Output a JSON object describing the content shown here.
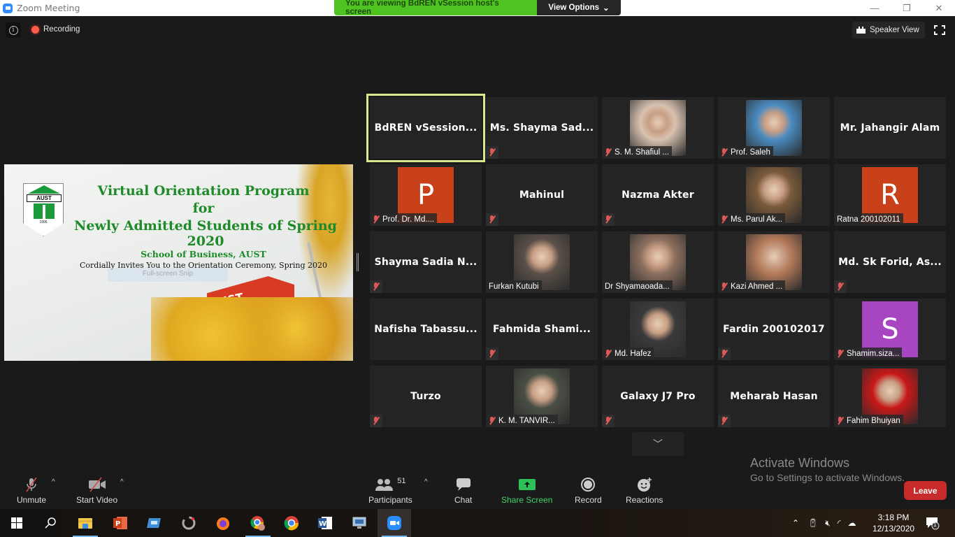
{
  "window": {
    "title": "Zoom Meeting",
    "controls": [
      "minimize",
      "restore",
      "close"
    ]
  },
  "banner": {
    "message": "You are viewing BdREN vSession host's screen",
    "view_options": "View Options"
  },
  "topbar": {
    "recording": "Recording",
    "speaker_view": "Speaker View"
  },
  "shared_screen": {
    "title_line1": "Virtual Orientation Program",
    "title_line2": "for",
    "title_line3": "Newly Admitted Students of Spring 2020",
    "subtitle": "School of Business, AUST",
    "invite": "Cordially Invites You to the Orientation Ceremony, Spring 2020",
    "snip_overlay": "Full-screen Snip",
    "logo_text": "AUST",
    "logo_year": "1995",
    "building_text": "AUST"
  },
  "participants_grid": [
    {
      "name": "BdREN  vSession...",
      "type": "name",
      "muted": false,
      "active": true
    },
    {
      "name": "Ms.  Shayma  Sad...",
      "type": "name",
      "muted": true
    },
    {
      "name": "S. M. Shafiul ...",
      "type": "photo",
      "muted": true,
      "photo_color": "#d9c2b0"
    },
    {
      "name": "Prof. Saleh",
      "type": "photo",
      "muted": true,
      "photo_color": "#4a8bc0"
    },
    {
      "name": "Mr. Jahangir Alam",
      "type": "name",
      "muted": false
    },
    {
      "name": "Prof. Dr. Md....",
      "type": "initial",
      "initial": "P",
      "color": "#c8411a",
      "muted": true
    },
    {
      "name": "Mahinul",
      "type": "name",
      "muted": true
    },
    {
      "name": "Nazma Akter",
      "type": "name",
      "muted": true
    },
    {
      "name": "Ms. Parul Ak...",
      "type": "photo",
      "muted": true,
      "photo_color": "#7a5a3a"
    },
    {
      "name": "Ratna 200102011",
      "type": "initial",
      "initial": "R",
      "color": "#c8411a",
      "muted": false
    },
    {
      "name": "Shayma  Sadia  N...",
      "type": "name",
      "muted": true
    },
    {
      "name": "Furkan Kutubi",
      "type": "photo",
      "muted": false,
      "photo_color": "#5a5048"
    },
    {
      "name": "Dr Shyamaoada...",
      "type": "photo",
      "muted": false,
      "photo_color": "#8c6f5e"
    },
    {
      "name": "Kazi Ahmed ...",
      "type": "photo",
      "muted": true,
      "photo_color": "#b47a5a"
    },
    {
      "name": "Md.  Sk  Forid,  As...",
      "type": "name",
      "muted": true
    },
    {
      "name": "Nafisha  Tabassu...",
      "type": "name",
      "muted": false
    },
    {
      "name": "Fahmida  Shami...",
      "type": "name",
      "muted": true
    },
    {
      "name": "Md. Hafez",
      "type": "photo",
      "muted": true,
      "photo_color": "#3a3a3a"
    },
    {
      "name": "Fardin 200102017",
      "type": "name",
      "muted": true
    },
    {
      "name": "Shamim.siza...",
      "type": "initial",
      "initial": "S",
      "color": "#a845c0",
      "muted": true
    },
    {
      "name": "Turzo",
      "type": "name",
      "muted": true
    },
    {
      "name": "K. M. TANVIR...",
      "type": "photo",
      "muted": true,
      "photo_color": "#4a4f44"
    },
    {
      "name": "Galaxy J7 Pro",
      "type": "name",
      "muted": true
    },
    {
      "name": "Meharab Hasan",
      "type": "name",
      "muted": true
    },
    {
      "name": "Fahim Bhuiyan",
      "type": "photo",
      "muted": true,
      "photo_color": "#c81818"
    }
  ],
  "toolbar": {
    "unmute": "Unmute",
    "start_video": "Start Video",
    "participants": "Participants",
    "participants_count": "51",
    "chat": "Chat",
    "share_screen": "Share Screen",
    "record": "Record",
    "reactions": "Reactions",
    "leave": "Leave"
  },
  "watermark": {
    "line1": "Activate Windows",
    "line2": "Go to Settings to activate Windows."
  },
  "taskbar": {
    "apps": [
      "start",
      "search",
      "file-explorer",
      "powerpoint",
      "app-blue",
      "app-gray",
      "firefox",
      "chrome-profile",
      "chrome",
      "word",
      "network-app",
      "zoom"
    ],
    "time": "3:18 PM",
    "date": "12/13/2020",
    "notifications": "1"
  },
  "colors": {
    "accent_green": "#4fc321",
    "leave_red": "#c82b2b",
    "active_border": "#d8e88a"
  }
}
